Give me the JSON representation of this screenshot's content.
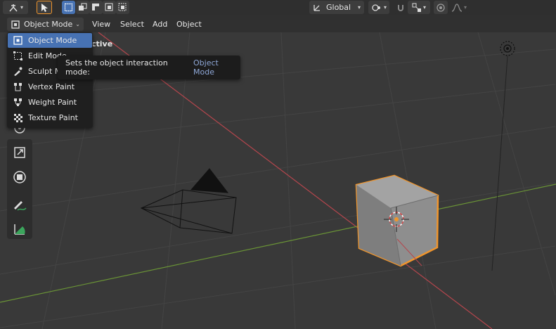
{
  "header": {
    "mode_button_label": "Object Mode",
    "menu": {
      "view": "View",
      "select": "Select",
      "add": "Add",
      "object": "Object"
    },
    "transform_orientation": "Global"
  },
  "mode_menu": {
    "items": [
      {
        "label": "Object Mode",
        "icon": "object-mode-icon",
        "selected": true
      },
      {
        "label": "Edit Mode",
        "icon": "edit-mode-icon",
        "selected": false
      },
      {
        "label": "Sculpt Mode",
        "icon": "sculpt-mode-icon",
        "selected": false
      },
      {
        "label": "Vertex Paint",
        "icon": "vertex-paint-icon",
        "selected": false
      },
      {
        "label": "Weight Paint",
        "icon": "weight-paint-icon",
        "selected": false
      },
      {
        "label": "Texture Paint",
        "icon": "texture-paint-icon",
        "selected": false
      }
    ]
  },
  "tooltip": {
    "text": "Sets the object interaction mode:",
    "value": "Object Mode"
  },
  "viewport": {
    "overlay_partial": "ctive"
  },
  "colors": {
    "accent": "#4772b3",
    "selection_outline": "#f0952c",
    "x_axis": "#b5464d",
    "y_axis": "#6a9436",
    "background": "#393939"
  }
}
